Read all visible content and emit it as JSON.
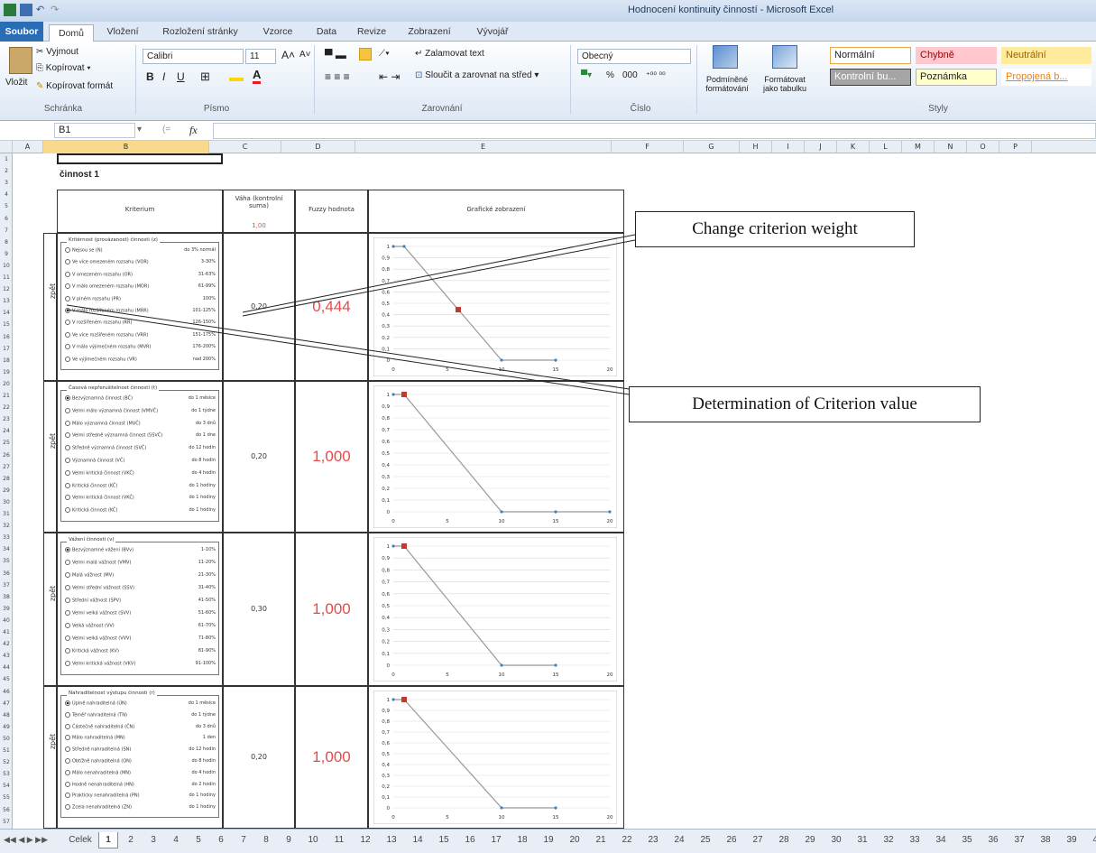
{
  "window": {
    "title": "Hodnocení kontinuity činností - Microsoft Excel"
  },
  "ribbon_tabs": [
    "Soubor",
    "Domů",
    "Vložení",
    "Rozložení stránky",
    "Vzorce",
    "Data",
    "Revize",
    "Zobrazení",
    "Vývojář"
  ],
  "clipboard": {
    "paste": "Vložit",
    "cut": "Vyjmout",
    "copy": "Kopírovat ▾",
    "format_painter": "Kopírovat formát",
    "group": "Schránka"
  },
  "font": {
    "name": "Calibri",
    "size": "11",
    "group": "Písmo",
    "bold": "B",
    "italic": "I",
    "underline": "U"
  },
  "alignment": {
    "wrap": "Zalamovat text",
    "merge": "Sloučit a zarovnat na střed ▾",
    "group": "Zarovnání"
  },
  "number": {
    "format": "Obecný",
    "group": "Číslo",
    "percent": "%",
    "thousands": "000"
  },
  "styles": {
    "conditional": "Podmíněné formátování",
    "as_table": "Formátovat jako tabulku",
    "group": "Styly",
    "cells": [
      {
        "label": "Normální",
        "bg": "#ffffff",
        "color": "#222222",
        "border": "#e6a84a"
      },
      {
        "label": "Chybně",
        "bg": "#ffc7ce",
        "color": "#9c0006",
        "border": "#ffc7ce"
      },
      {
        "label": "Neutrální",
        "bg": "#ffeb9c",
        "color": "#9c6500",
        "border": "#ffeb9c"
      },
      {
        "label": "Kontrolní bu...",
        "bg": "#a5a5a5",
        "color": "#ffffff",
        "border": "#3f3f3f"
      },
      {
        "label": "Poznámka",
        "bg": "#ffffcc",
        "color": "#222222",
        "border": "#b2b2b2"
      },
      {
        "label": "Propojená b...",
        "bg": "#ffffff",
        "color": "#fa7d00",
        "border": "#ffffff"
      }
    ]
  },
  "formula_bar": {
    "name_box": "B1",
    "fx": "fx"
  },
  "columns": [
    "A",
    "B",
    "C",
    "D",
    "E",
    "F",
    "G",
    "H",
    "I",
    "J",
    "K",
    "L",
    "M",
    "N",
    "O",
    "P"
  ],
  "sheet": {
    "title": "činnost 1",
    "headers": {
      "criterion": "Kriterium",
      "weight": "Váha (kontrolní suma)",
      "weight_sum": "1,00",
      "fuzzy": "Fuzzy hodnota",
      "graph": "Grafické zobrazení"
    },
    "side_label": "zpět",
    "blocks": [
      {
        "title": "Kritérnost (provázanost) činnosti (z)",
        "weight": "0,20",
        "fuzzy": "0,444",
        "options": [
          {
            "label": "Nejsou se (N)",
            "value": "do 3% normál",
            "on": false
          },
          {
            "label": "Ve více omezeném rozsahu (VOR)",
            "value": "3-30%",
            "on": false
          },
          {
            "label": "V omezeném rozsahu (OR)",
            "value": "31-63%",
            "on": false
          },
          {
            "label": "V málo omezeném rozsahu (MOR)",
            "value": "61-99%",
            "on": false
          },
          {
            "label": "V plném rozsahu (PR)",
            "value": "100%",
            "on": false
          },
          {
            "label": "V málo rozšířeném rozsahu (MRR)",
            "value": "101-125%",
            "on": true
          },
          {
            "label": "V rozšířeném rozsahu (RR)",
            "value": "126-150%",
            "on": false
          },
          {
            "label": "Ve více rozšířeném rozsahu (VRR)",
            "value": "151-175%",
            "on": false
          },
          {
            "label": "V málo výjimečném rozsahu (MVR)",
            "value": "176-200%",
            "on": false
          },
          {
            "label": "Ve výjimečném rozsahu (VR)",
            "value": "nad 200%",
            "on": false
          }
        ]
      },
      {
        "title": "Časová nepřerušitelnost činnosti (t)",
        "weight": "0,20",
        "fuzzy": "1,000",
        "options": [
          {
            "label": "Bezvýznamná činnost (BČ)",
            "value": "do 1 měsíce",
            "on": true
          },
          {
            "label": "Velmi málo významná činnost (VMVČ)",
            "value": "do 1 týdne",
            "on": false
          },
          {
            "label": "Málo významná činnost (MVČ)",
            "value": "do 3 dnů",
            "on": false
          },
          {
            "label": "Velmi středně významná činnost (SSVČ)",
            "value": "do 1 dne",
            "on": false
          },
          {
            "label": "Středně významná činnost (SVČ)",
            "value": "do 12 hodin",
            "on": false
          },
          {
            "label": "Významná činnost (VČ)",
            "value": "do 8 hodin",
            "on": false
          },
          {
            "label": "Velmi kritická činnost (VKČ)",
            "value": "do 4 hodin",
            "on": false
          },
          {
            "label": "Kritická činnost (KČ)",
            "value": "do 1 hodiny",
            "on": false
          },
          {
            "label": "Velmi kritická činnost (VKČ)",
            "value": "do 1 hodiny",
            "on": false
          },
          {
            "label": "Kritická činnost (KČ)",
            "value": "do 1 hodiny",
            "on": false
          }
        ]
      },
      {
        "title": "Vážení činnosti (v)",
        "weight": "0,30",
        "fuzzy": "1,000",
        "options": [
          {
            "label": "Bezvýznamné vážení (BVv)",
            "value": "1-10%",
            "on": true
          },
          {
            "label": "Velmi malá vážnost (VMV)",
            "value": "11-20%",
            "on": false
          },
          {
            "label": "Malá vážnost (MV)",
            "value": "21-30%",
            "on": false
          },
          {
            "label": "Velmi střední vážnost (SSV)",
            "value": "31-40%",
            "on": false
          },
          {
            "label": "Střední vážnost (SPV)",
            "value": "41-50%",
            "on": false
          },
          {
            "label": "Velmi velká vážnost (SVV)",
            "value": "51-60%",
            "on": false
          },
          {
            "label": "Velká vážnost (VV)",
            "value": "61-70%",
            "on": false
          },
          {
            "label": "Velmi velká vážnost (VVV)",
            "value": "71-80%",
            "on": false
          },
          {
            "label": "Kritická vážnost (KV)",
            "value": "81-90%",
            "on": false
          },
          {
            "label": "Velmi kritická vážnost (VKV)",
            "value": "91-100%",
            "on": false
          }
        ]
      },
      {
        "title": "Nahraditelnost výstupu činnosti (r)",
        "weight": "0,20",
        "fuzzy": "1,000",
        "options": [
          {
            "label": "Úplně nahraditelná (ÚN)",
            "value": "do 1 měsíce",
            "on": true
          },
          {
            "label": "Téměř nahraditelná (TN)",
            "value": "do 1 týdne",
            "on": false
          },
          {
            "label": "Částečně nahraditelná (ČN)",
            "value": "do 3 dnů",
            "on": false
          },
          {
            "label": "Málo nahraditelná (MN)",
            "value": "1 den",
            "on": false
          },
          {
            "label": "Středně nahraditelná (SN)",
            "value": "do 12 hodin",
            "on": false
          },
          {
            "label": "Obtížně nahraditelná (ON)",
            "value": "do 8 hodin",
            "on": false
          },
          {
            "label": "Málo nenahraditelná (MN)",
            "value": "do 4 hodin",
            "on": false
          },
          {
            "label": "Hodně nenahraditelná (HN)",
            "value": "do 2 hodin",
            "on": false
          },
          {
            "label": "Prakticky nenahraditelná (PN)",
            "value": "do 1 hodiny",
            "on": false
          },
          {
            "label": "Zcela nenahraditelná (ZN)",
            "value": "do 1 hodiny",
            "on": false
          }
        ]
      }
    ]
  },
  "chart_data": [
    {
      "type": "line",
      "x": [
        0,
        1,
        10,
        15,
        20
      ],
      "y": [
        1,
        1,
        0,
        0,
        null
      ],
      "marker": {
        "x": 6,
        "y": 0.444
      },
      "ylim": [
        0,
        1
      ],
      "xlim": [
        0,
        20
      ],
      "xticks": [
        0,
        5,
        10,
        15,
        20
      ],
      "yticks": [
        0,
        0.1,
        0.2,
        0.3,
        0.4,
        0.5,
        0.6,
        0.7,
        0.8,
        0.9,
        1
      ]
    },
    {
      "type": "line",
      "x": [
        0,
        1,
        10,
        15,
        20
      ],
      "y": [
        1,
        1,
        0,
        0,
        0
      ],
      "marker": {
        "x": 1,
        "y": 1
      },
      "ylim": [
        0,
        1
      ],
      "xlim": [
        0,
        20
      ],
      "xticks": [
        0,
        5,
        10,
        15,
        20
      ],
      "yticks": [
        0,
        0.1,
        0.2,
        0.3,
        0.4,
        0.5,
        0.6,
        0.7,
        0.8,
        0.9,
        1
      ]
    },
    {
      "type": "line",
      "x": [
        0,
        1,
        10,
        15,
        20
      ],
      "y": [
        1,
        1,
        0,
        0,
        null
      ],
      "marker": {
        "x": 1,
        "y": 1
      },
      "ylim": [
        0,
        1
      ],
      "xlim": [
        0,
        20
      ],
      "xticks": [
        0,
        5,
        10,
        15,
        20
      ],
      "yticks": [
        0,
        0.1,
        0.2,
        0.3,
        0.4,
        0.5,
        0.6,
        0.7,
        0.8,
        0.9,
        1
      ]
    },
    {
      "type": "line",
      "x": [
        0,
        1,
        10,
        15,
        20
      ],
      "y": [
        1,
        1,
        0,
        0,
        null
      ],
      "marker": {
        "x": 1,
        "y": 1
      },
      "ylim": [
        0,
        1
      ],
      "xlim": [
        0,
        20
      ],
      "xticks": [
        0,
        5,
        10,
        15,
        20
      ],
      "yticks": [
        0,
        0.1,
        0.2,
        0.3,
        0.4,
        0.5,
        0.6,
        0.7,
        0.8,
        0.9,
        1
      ]
    }
  ],
  "callouts": {
    "weight": "Change criterion weight",
    "value": "Determination of Criterion value"
  },
  "sheet_tabs": [
    "Celek",
    "1",
    "2",
    "3",
    "4",
    "5",
    "6",
    "7",
    "8",
    "9",
    "10",
    "11",
    "12",
    "13",
    "14",
    "15",
    "16",
    "17",
    "18",
    "19",
    "20",
    "21",
    "22",
    "23",
    "24",
    "25",
    "26",
    "27",
    "28",
    "29",
    "30",
    "31",
    "32",
    "33",
    "34",
    "35",
    "36",
    "37",
    "38",
    "39",
    "40"
  ],
  "active_sheet": "1"
}
